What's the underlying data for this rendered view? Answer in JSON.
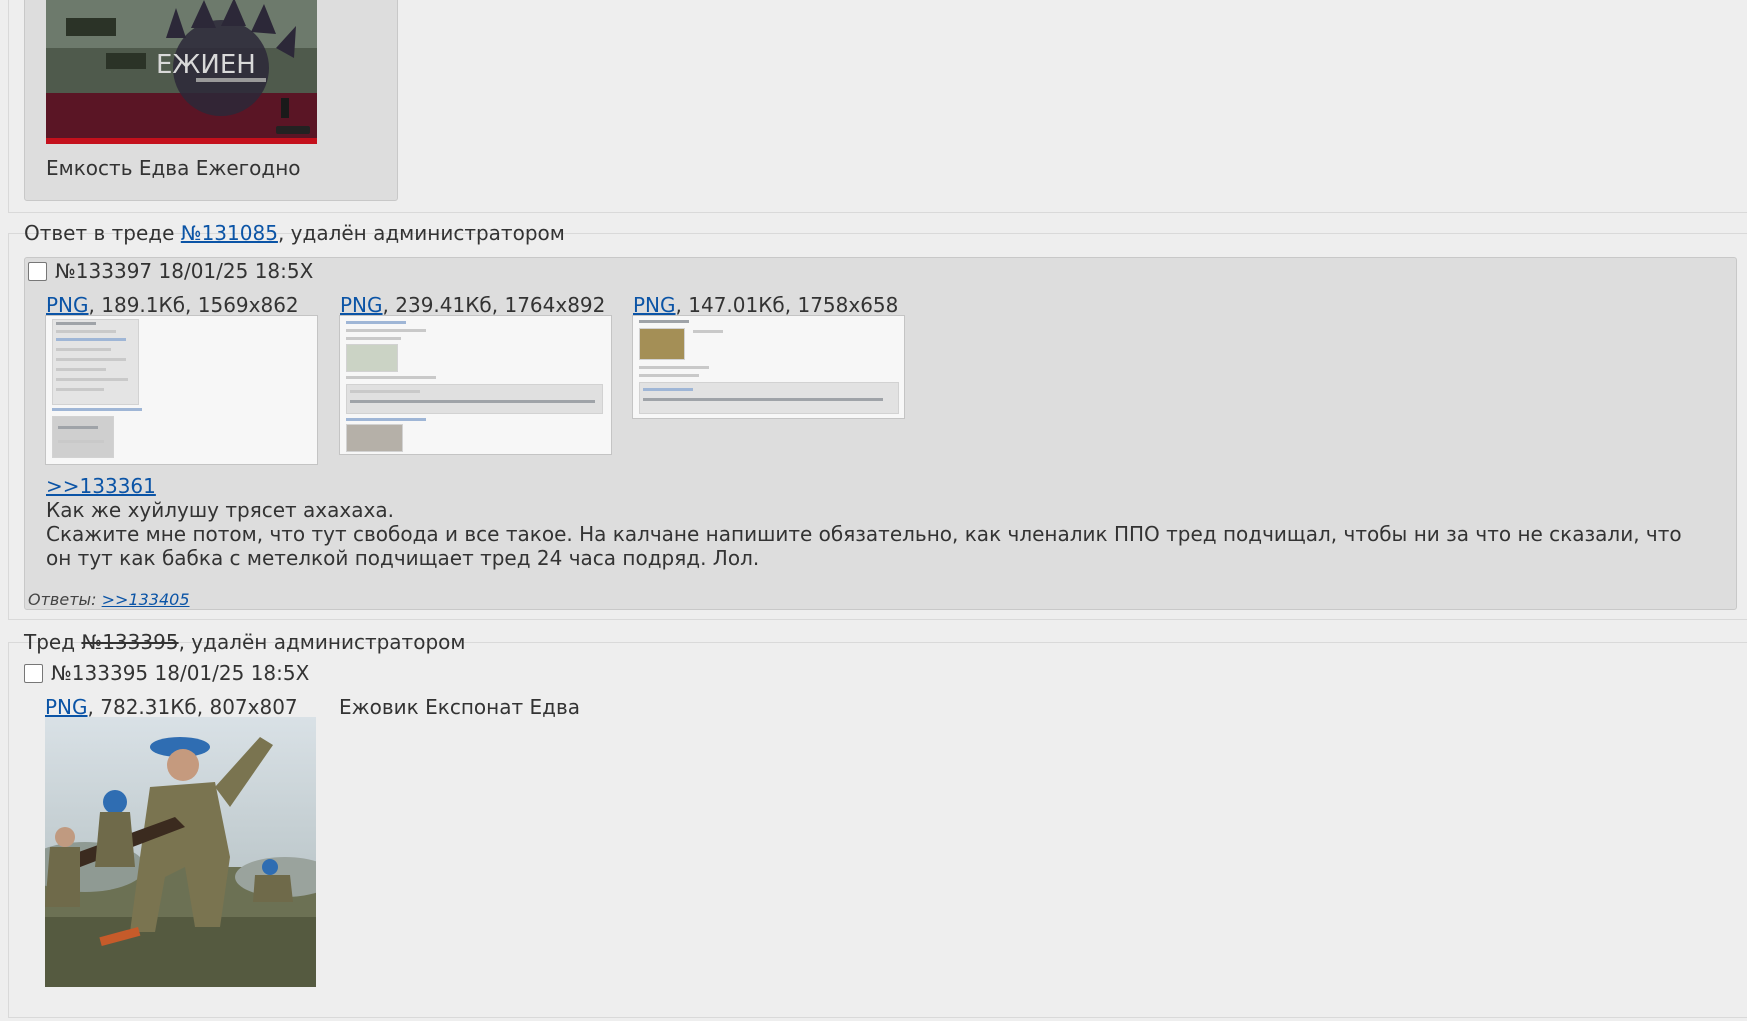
{
  "top_post": {
    "text": "Емкость Едва Ежегодно"
  },
  "reply_section": {
    "prefix": "Ответ в треде ",
    "thread_link": "№131085",
    "suffix": ", удалён администратором",
    "post": {
      "number": "№133397",
      "datetime": "18/01/25 18:5X",
      "files": [
        {
          "type": "PNG",
          "meta": ", 189.1Кб, 1569x862"
        },
        {
          "type": "PNG",
          "meta": ", 239.41Кб, 1764x892"
        },
        {
          "type": "PNG",
          "meta": ", 147.01Кб, 1758x658"
        }
      ],
      "quote_link": ">>133361",
      "lines": [
        "Как же хуйлушу трясет ахахаха.",
        "Скажите мне потом, что тут свобода и все такое. На калчане напишите обязательно, как членалик ППО тред подчищал, чтобы ни за что не сказали, что он тут как бабка с метелкой подчищает тред 24 часа подряд. Лол."
      ],
      "replies_label": "Ответы: ",
      "replies_link": ">>133405"
    }
  },
  "thread_section": {
    "prefix": "Тред ",
    "thread_number": "№133395",
    "suffix": ", удалён администратором",
    "post": {
      "number": "№133395",
      "datetime": "18/01/25 18:5X",
      "file": {
        "type": "PNG",
        "meta": ", 782.31Кб, 807x807"
      },
      "text": "Ежовик Експонат Едва"
    }
  },
  "colors": {
    "background": "#eeeeee",
    "post_background": "#dddddd",
    "link": "#0b54a6",
    "text": "#333333"
  }
}
